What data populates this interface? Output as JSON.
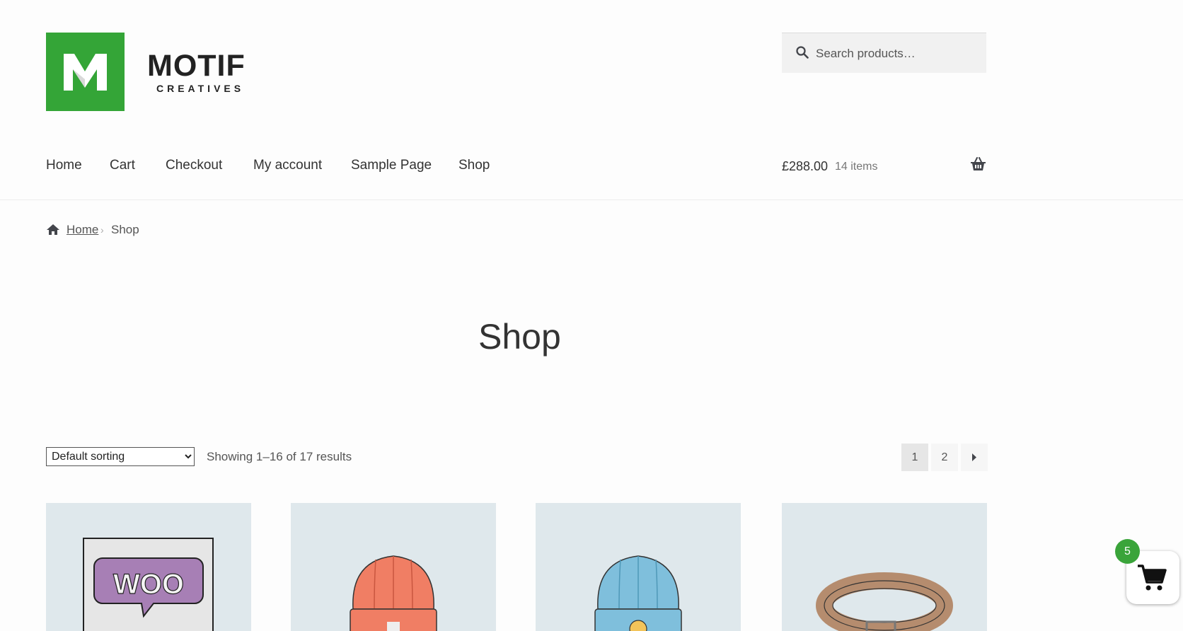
{
  "brand": {
    "name": "MOTIF",
    "subtitle": "CREATIVES",
    "logo_letter": "M",
    "logo_color": "#34a537"
  },
  "search": {
    "placeholder": "Search products…",
    "icon": "search-icon"
  },
  "nav": {
    "items": [
      "Home",
      "Cart",
      "Checkout",
      "My account",
      "Sample Page",
      "Shop"
    ]
  },
  "header_cart": {
    "total": "£288.00",
    "count": "14 items",
    "icon": "basket-icon"
  },
  "breadcrumb": {
    "home": "Home",
    "separator": "›",
    "current": "Shop",
    "icon": "home-icon"
  },
  "page": {
    "title": "Shop"
  },
  "toolbar": {
    "sorting_selected": "Default sorting",
    "result_count": "Showing 1–16 of 17 results",
    "pages": [
      "1",
      "2"
    ],
    "current_page": "1",
    "next_icon": "caret-right-icon"
  },
  "products": [
    {
      "image": "woo-logo-poster"
    },
    {
      "image": "orange-beanie"
    },
    {
      "image": "blue-beanie"
    },
    {
      "image": "leather-belt"
    }
  ],
  "floating_cart": {
    "badge": "5",
    "icon": "cart-icon",
    "badge_color": "#3aa43a"
  }
}
